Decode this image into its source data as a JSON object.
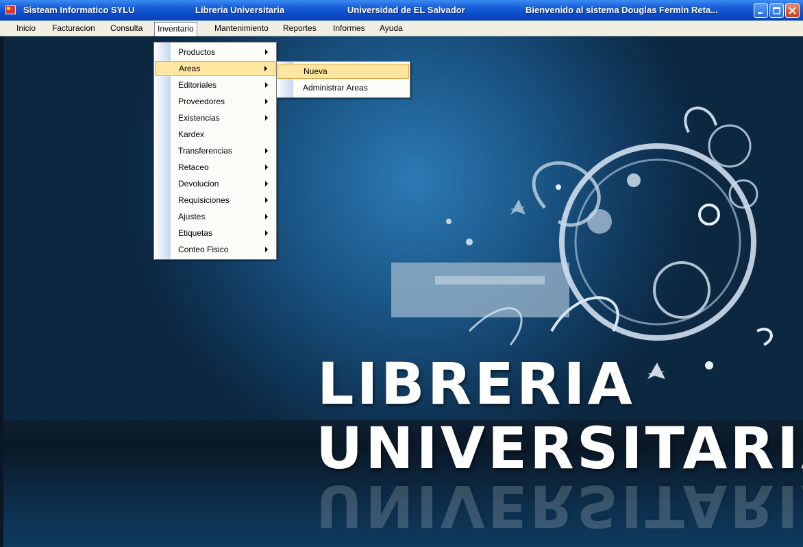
{
  "window": {
    "title_segments": [
      "Sisteam Informatico SYLU",
      "Libreria Universitaria",
      "Universidad de EL Salvador",
      "Bienvenido al sistema Douglas Fermin Reta..."
    ],
    "icon": "app-icon",
    "controls": [
      "minimize-icon",
      "maximize-icon",
      "close-icon"
    ]
  },
  "menubar": {
    "items": [
      "Inicio",
      "Facturacion",
      "Consulta",
      "Inventario",
      "Mantenimiento",
      "Reportes",
      "Informes",
      "Ayuda"
    ],
    "open_item": "Inventario"
  },
  "inventario_menu": {
    "items": [
      {
        "label": "Productos",
        "submenu": true
      },
      {
        "label": "Areas",
        "submenu": true,
        "highlighted": true
      },
      {
        "label": "Editoriales",
        "submenu": true
      },
      {
        "label": "Proveedores",
        "submenu": true
      },
      {
        "label": "Existencias",
        "submenu": true
      },
      {
        "label": "Kardex",
        "submenu": false
      },
      {
        "label": "Transferencias",
        "submenu": true
      },
      {
        "label": "Retaceo",
        "submenu": true
      },
      {
        "label": "Devolucion",
        "submenu": true
      },
      {
        "label": "Requisiciones",
        "submenu": true
      },
      {
        "label": "Ajustes",
        "submenu": true
      },
      {
        "label": "Etiquetas",
        "submenu": true
      },
      {
        "label": "Conteo Fisico",
        "submenu": true
      }
    ]
  },
  "areas_submenu": {
    "items": [
      {
        "label": "Nueva",
        "highlighted": true
      },
      {
        "label": "Administrar Areas",
        "highlighted": false
      }
    ]
  },
  "background": {
    "line1": "LIBRERIA",
    "line2": "UNIVERSITARIA"
  },
  "colors": {
    "titlebar": "#0a4bc8",
    "menubar": "#f1efe2",
    "highlight": "#ffe7a2",
    "background": "#1a5585"
  }
}
